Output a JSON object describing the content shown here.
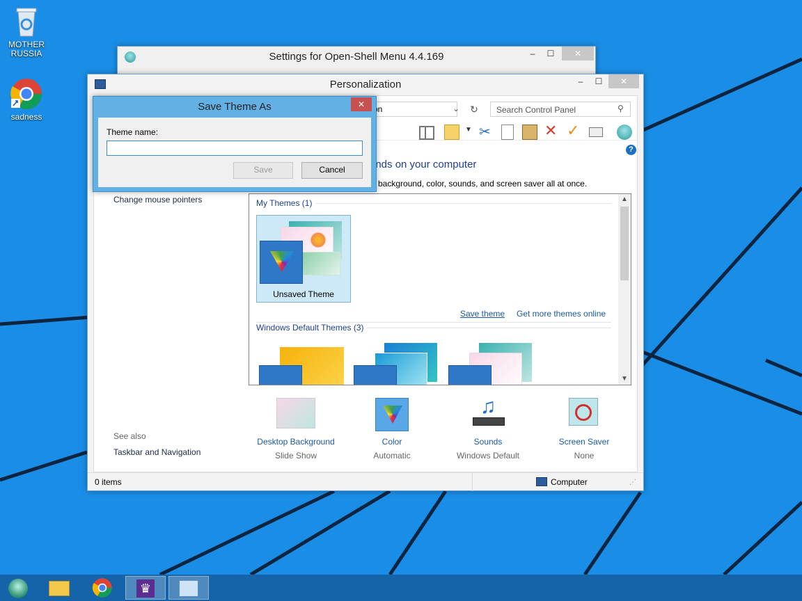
{
  "desktop": {
    "icons": [
      {
        "label_line1": "MOTHER",
        "label_line2": "RUSSIA",
        "icon": "recycle-bin-icon"
      },
      {
        "label_line1": "sadness",
        "icon": "chrome-icon"
      }
    ]
  },
  "openshell_window": {
    "title": "Settings for Open-Shell Menu 4.4.169"
  },
  "personalization": {
    "title": "Personalization",
    "address_text": "on",
    "search_placeholder": "Search Control Panel",
    "heading": "unds on your computer",
    "description": "p background, color, sounds, and screen saver all at once.",
    "left_nav": {
      "change_mouse_pointers": "Change mouse pointers",
      "see_also": "See also",
      "taskbar_navigation": "Taskbar and Navigation"
    },
    "my_themes_header": "My Themes (1)",
    "unsaved_theme": "Unsaved Theme",
    "save_theme_link": "Save theme",
    "get_more_link": "Get more themes online",
    "windows_default_header": "Windows Default Themes (3)",
    "bottom_items": [
      {
        "label": "Desktop Background",
        "sub": "Slide Show"
      },
      {
        "label": "Color",
        "sub": "Automatic"
      },
      {
        "label": "Sounds",
        "sub": "Windows Default"
      },
      {
        "label": "Screen Saver",
        "sub": "None"
      }
    ],
    "status_left": "0 items",
    "status_right": "Computer"
  },
  "dialog": {
    "title": "Save Theme As",
    "field_label": "Theme name:",
    "field_value": "",
    "save_label": "Save",
    "cancel_label": "Cancel"
  },
  "colors": {
    "desktop": "#1a8ee6",
    "taskbar": "#1563a8",
    "dialog_frame": "#62b0e4",
    "dialog_close": "#c75050"
  }
}
